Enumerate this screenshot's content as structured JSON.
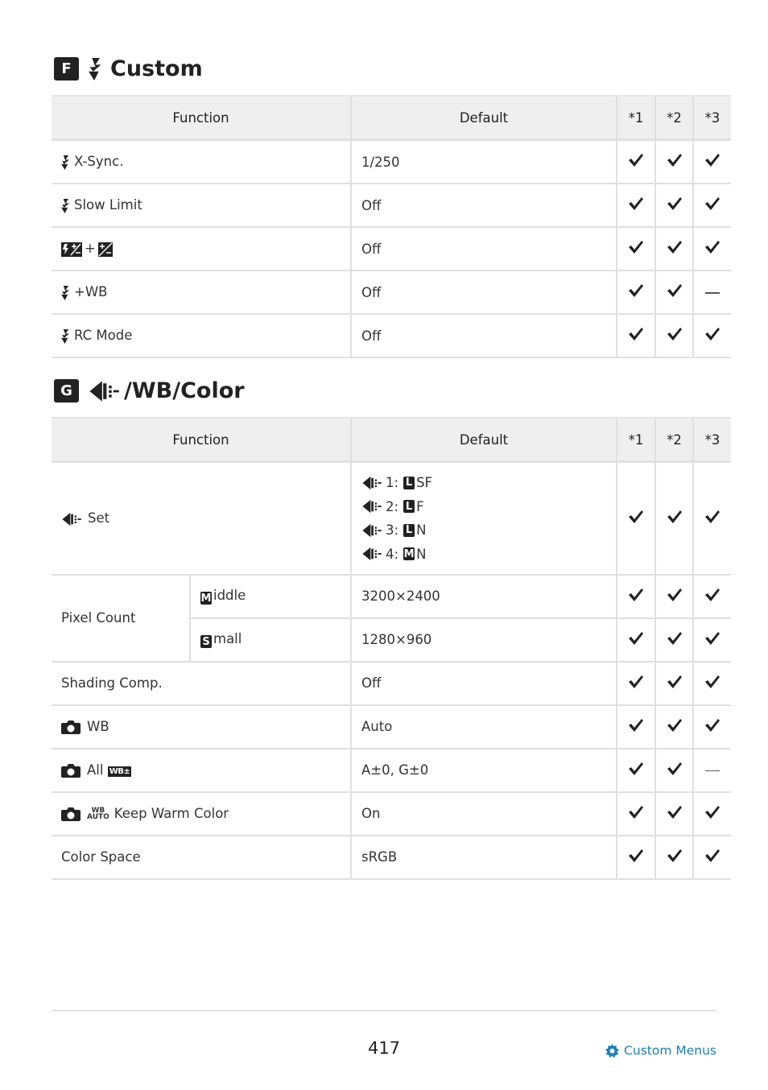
{
  "section_f": {
    "badge": "F",
    "title": "Custom",
    "icon": "flash-icon",
    "headers": [
      "Function",
      "Default",
      "*1",
      "*2",
      "*3"
    ],
    "rows": [
      {
        "icon": "flash-icon",
        "function": "X-Sync.",
        "default": "1/250",
        "marks": [
          "check",
          "check",
          "check"
        ]
      },
      {
        "icon": "flash-icon",
        "function": "Slow Limit",
        "default": "Off",
        "marks": [
          "check",
          "check",
          "check"
        ]
      },
      {
        "icon": "flash-exposure-comp-plus-exposure-comp-icon",
        "function": "+",
        "default": "Off",
        "marks": [
          "check",
          "check",
          "check"
        ]
      },
      {
        "icon": "flash-icon",
        "function": "+WB",
        "default": "Off",
        "marks": [
          "check",
          "check",
          "dash"
        ]
      },
      {
        "icon": "flash-icon",
        "function": "RC Mode",
        "default": "Off",
        "marks": [
          "check",
          "check",
          "check"
        ]
      }
    ]
  },
  "section_g": {
    "badge": "G",
    "title": "/WB/Color",
    "icon": "image-quality-icon",
    "headers": [
      "Function",
      "Default",
      "*1",
      "*2",
      "*3"
    ],
    "set_row": {
      "function": "Set",
      "defaults": [
        {
          "num": "1:",
          "size": "L",
          "quality": "SF"
        },
        {
          "num": "2:",
          "size": "L",
          "quality": "F"
        },
        {
          "num": "3:",
          "size": "L",
          "quality": "N"
        },
        {
          "num": "4:",
          "size": "M",
          "quality": "N"
        }
      ],
      "marks": [
        "check",
        "check",
        "check"
      ]
    },
    "pixel_count": {
      "label": "Pixel Count",
      "rows": [
        {
          "badge": "M",
          "label": "iddle",
          "default": "3200×2400",
          "marks": [
            "check",
            "check",
            "check"
          ]
        },
        {
          "badge": "S",
          "label": "mall",
          "default": "1280×960",
          "marks": [
            "check",
            "check",
            "check"
          ]
        }
      ]
    },
    "rows": [
      {
        "icon": "",
        "function": "Shading Comp.",
        "default": "Off",
        "marks": [
          "check",
          "check",
          "check"
        ]
      },
      {
        "icon": "camera-icon",
        "function": "WB",
        "default": "Auto",
        "marks": [
          "check",
          "check",
          "check"
        ]
      },
      {
        "icon": "camera-icon",
        "function": "All",
        "badge": "WB±",
        "default": "A±0, G±0",
        "marks": [
          "check",
          "check",
          "dash"
        ]
      },
      {
        "icon": "camera-icon",
        "wbauto": [
          "WB",
          "AUTO"
        ],
        "function": "Keep Warm Color",
        "default": "On",
        "marks": [
          "check",
          "check",
          "check"
        ]
      },
      {
        "icon": "",
        "function": "Color Space",
        "default": "sRGB",
        "marks": [
          "check",
          "check",
          "check"
        ]
      }
    ]
  },
  "footer": {
    "page_number": "417",
    "link_label": "Custom Menus",
    "link_color": "#1a7fb5"
  }
}
